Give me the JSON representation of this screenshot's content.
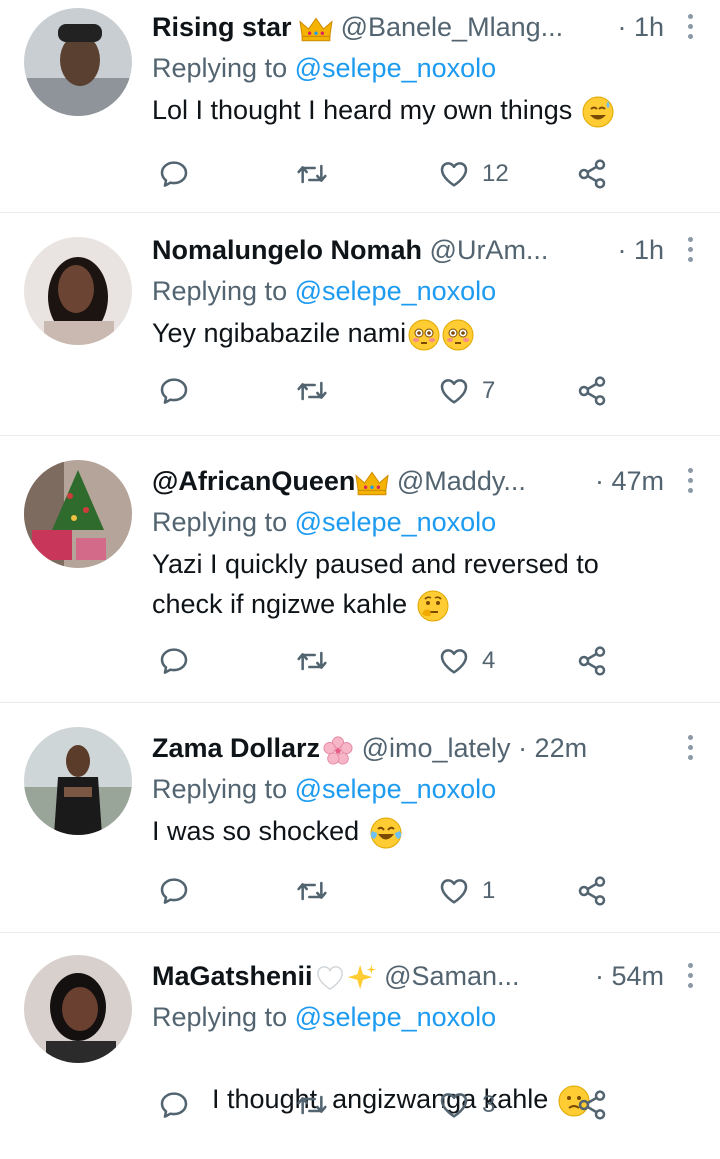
{
  "colors": {
    "accent": "#1d9bf0",
    "secondary_text": "#536471",
    "primary_text": "#0f1419",
    "divider": "#e6ecf0"
  },
  "tweets": [
    {
      "name": "Rising star",
      "name_emoji": "crown",
      "handle": "@Banele_Mlang...",
      "time": "· 1h",
      "replying_prefix": "Replying to",
      "replying_to": "@selepe_noxolo",
      "text": "Lol I thought I heard my own things",
      "text_emoji": "sweat-smile",
      "likes": "12"
    },
    {
      "name": "Nomalungelo Nomah",
      "name_emoji": "",
      "handle": "@UrAm...",
      "time": "· 1h",
      "replying_prefix": "Replying to",
      "replying_to": "@selepe_noxolo",
      "text": "Yey ngibabazile nami",
      "text_emoji": "flushed-flushed",
      "likes": "7"
    },
    {
      "name": "@AfricanQueen",
      "name_emoji": "crown",
      "handle": "@Maddy...",
      "time": "· 47m",
      "replying_prefix": "Replying to",
      "replying_to": "@selepe_noxolo",
      "text": "Yazi I quickly paused and reversed to check if ngizwe kahle",
      "text_emoji": "thinking",
      "likes": "4"
    },
    {
      "name": "Zama Dollarz",
      "name_emoji": "blossom",
      "handle": "@imo_lately",
      "time": "· 22m",
      "replying_prefix": "Replying to",
      "replying_to": "@selepe_noxolo",
      "text": "I was so shocked",
      "text_emoji": "joy",
      "likes": "1"
    },
    {
      "name": "MaGatshenii",
      "name_emoji": "white-heart-sparkles",
      "handle": "@Saman...",
      "time": "· 54m",
      "replying_prefix": "Replying to",
      "replying_to": "@selepe_noxolo",
      "text": "I thought  angizwanga kahle",
      "text_emoji": "confused",
      "likes": "3"
    }
  ]
}
